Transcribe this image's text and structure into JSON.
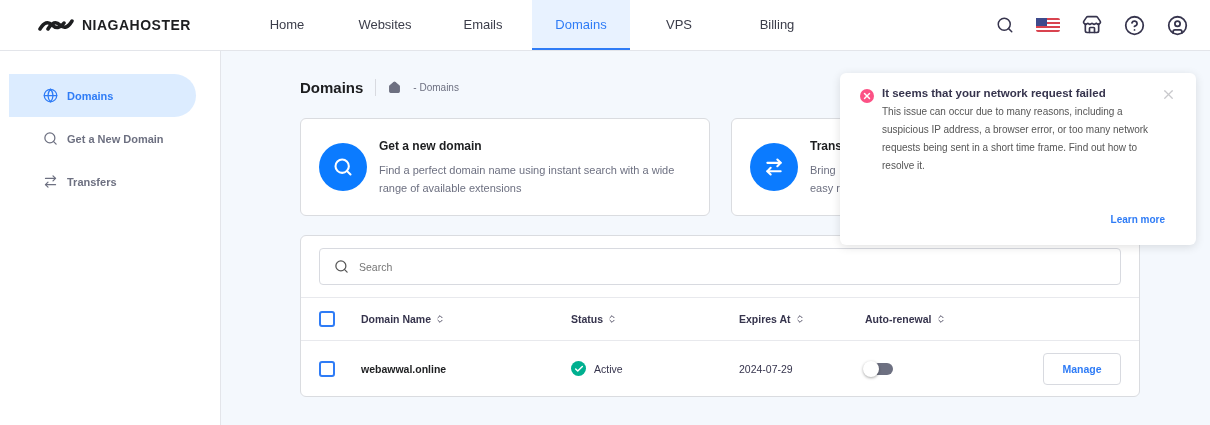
{
  "header": {
    "logo": "NIAGAHOSTER",
    "nav": [
      {
        "label": "Home",
        "selected": false
      },
      {
        "label": "Websites",
        "selected": false
      },
      {
        "label": "Emails",
        "selected": false
      },
      {
        "label": "Domains",
        "selected": true
      },
      {
        "label": "VPS",
        "selected": false
      },
      {
        "label": "Billing",
        "selected": false
      }
    ]
  },
  "sidebar": {
    "items": [
      {
        "label": "Domains",
        "selected": true
      },
      {
        "label": "Get a New Domain",
        "selected": false
      },
      {
        "label": "Transfers",
        "selected": false
      }
    ]
  },
  "page": {
    "title": "Domains",
    "breadcrumb": "- Domains"
  },
  "cards": [
    {
      "title": "Get a new domain",
      "description": "Find a perfect domain name using instant search with a wide range of available extensions"
    },
    {
      "title": "Trans",
      "description_lines": [
        "Bring",
        "easy r"
      ]
    }
  ],
  "table": {
    "search": {
      "placeholder": "Search"
    },
    "select_all": {
      "checked": false
    },
    "columns": [
      "Domain Name",
      "Status",
      "Expires At",
      "Auto-renewal"
    ],
    "rows": [
      {
        "checked": false,
        "domain": "webawwal.online",
        "status": "Active",
        "expires": "2024-07-29",
        "auto_renewal": false,
        "action": "Manage"
      }
    ]
  },
  "toast": {
    "title": "It seems that your network request failed",
    "message": "This issue can occur due to many reasons, including a suspicious IP address, a browser error, or too many network requests being sent in a short time frame. Find out how to resolve it.",
    "link": "Learn more"
  }
}
